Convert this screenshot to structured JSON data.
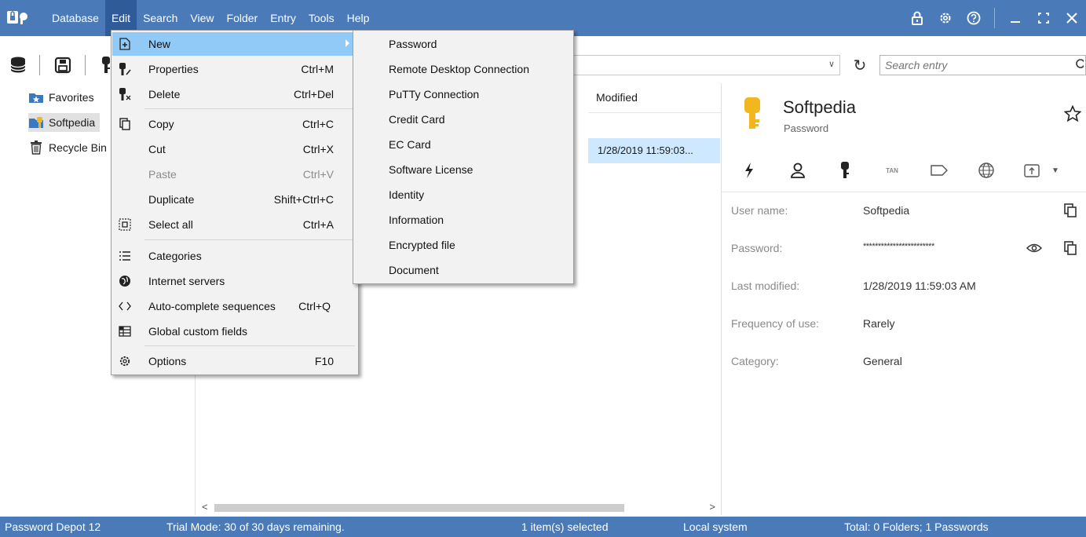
{
  "menubar": [
    "Database",
    "Edit",
    "Search",
    "View",
    "Folder",
    "Entry",
    "Tools",
    "Help"
  ],
  "search": {
    "placeholder": "Search entry"
  },
  "tree": [
    "Favorites",
    "Softpedia",
    "Recycle Bin"
  ],
  "list": {
    "col_modified": "Modified",
    "row_modified": "1/28/2019 11:59:03..."
  },
  "detail": {
    "title": "Softpedia",
    "subtitle": "Password",
    "tan_label": "TAN",
    "fields": [
      {
        "label": "User name:",
        "value": "Softpedia"
      },
      {
        "label": "Password:",
        "value": "************************"
      },
      {
        "label": "Last modified:",
        "value": "1/28/2019 11:59:03 AM"
      },
      {
        "label": "Frequency of use:",
        "value": "Rarely"
      },
      {
        "label": "Category:",
        "value": "General"
      }
    ]
  },
  "edit_menu": [
    {
      "label": "New",
      "shortcut": ""
    },
    {
      "label": "Properties",
      "shortcut": "Ctrl+M"
    },
    {
      "label": "Delete",
      "shortcut": "Ctrl+Del"
    },
    {
      "label": "Copy",
      "shortcut": "Ctrl+C"
    },
    {
      "label": "Cut",
      "shortcut": "Ctrl+X"
    },
    {
      "label": "Paste",
      "shortcut": "Ctrl+V"
    },
    {
      "label": "Duplicate",
      "shortcut": "Shift+Ctrl+C"
    },
    {
      "label": "Select all",
      "shortcut": "Ctrl+A"
    },
    {
      "label": "Categories",
      "shortcut": ""
    },
    {
      "label": "Internet servers",
      "shortcut": ""
    },
    {
      "label": "Auto-complete sequences",
      "shortcut": "Ctrl+Q"
    },
    {
      "label": "Global custom fields",
      "shortcut": ""
    },
    {
      "label": "Options",
      "shortcut": "F10"
    }
  ],
  "new_menu": [
    "Password",
    "Remote Desktop Connection",
    "PuTTy Connection",
    "Credit Card",
    "EC Card",
    "Software License",
    "Identity",
    "Information",
    "Encrypted file",
    "Document"
  ],
  "status": {
    "app": "Password Depot 12",
    "trial": "Trial Mode: 30 of 30 days remaining.",
    "selected": "1 item(s) selected",
    "location": "Local system",
    "total": "Total: 0 Folders; 1 Passwords"
  },
  "colors": {
    "accent": "#4a7ab8",
    "menu_highlight": "#91c9f7",
    "selection": "#cde8ff",
    "key_gold": "#f2b71f"
  }
}
